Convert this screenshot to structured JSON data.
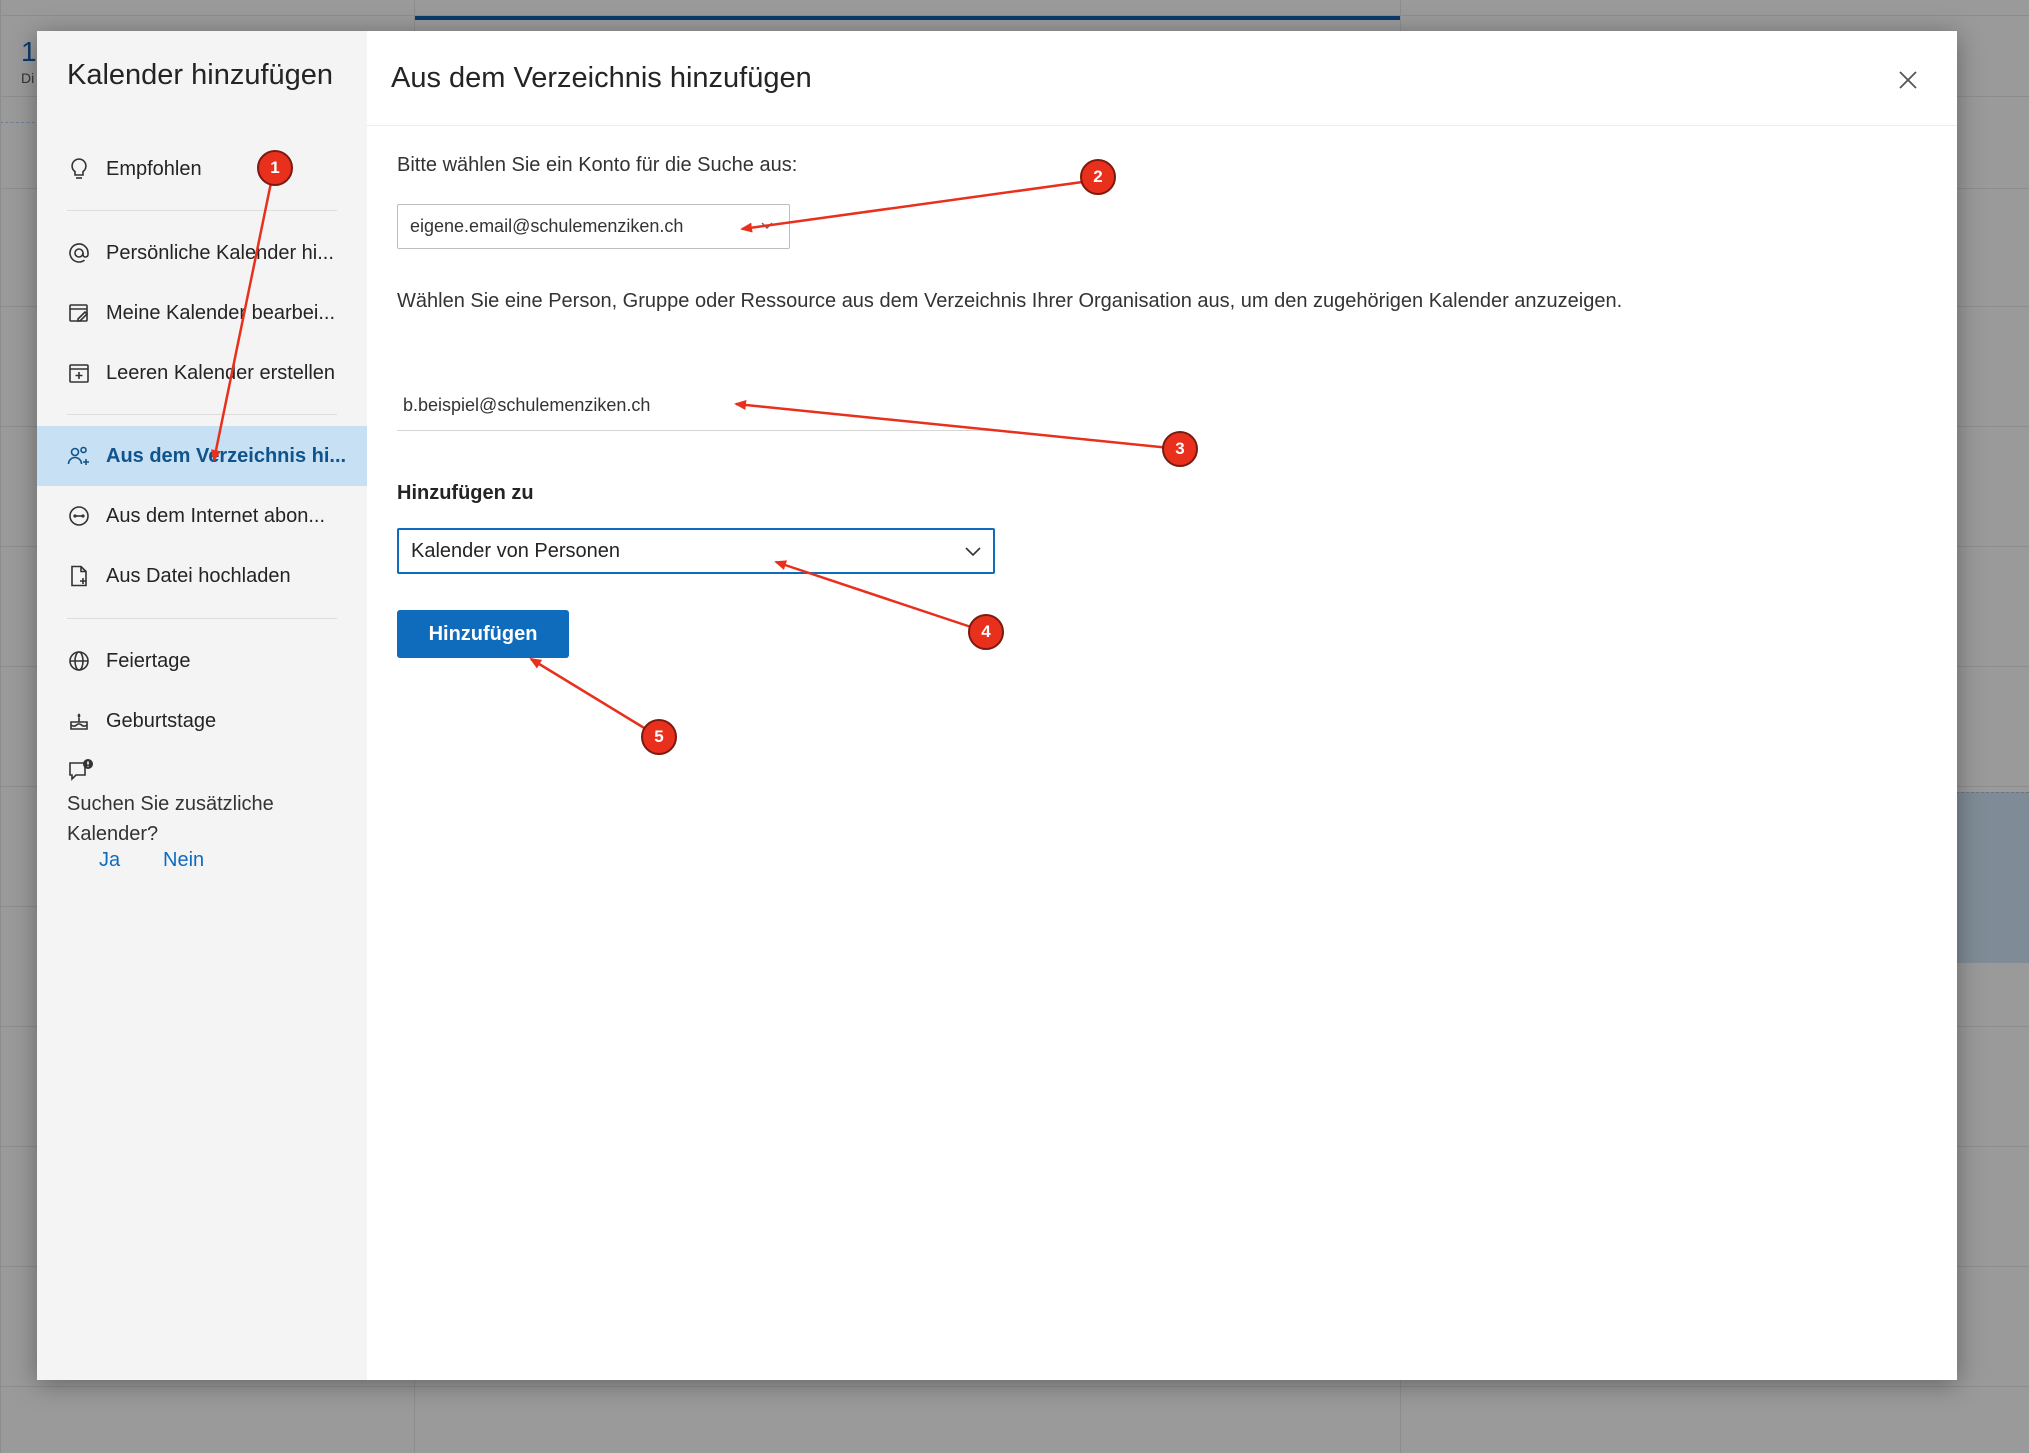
{
  "background": {
    "date_number": "1",
    "day_abbrev": "Di"
  },
  "sidebar": {
    "title": "Kalender hinzufügen",
    "items": [
      {
        "label": "Empfohlen",
        "icon": "lightbulb-icon"
      },
      {
        "label": "Persönliche Kalender hi...",
        "icon": "at-sign-icon"
      },
      {
        "label": "Meine Kalender bearbei...",
        "icon": "edit-calendar-icon"
      },
      {
        "label": "Leeren Kalender erstellen",
        "icon": "calendar-add-icon"
      },
      {
        "label": "Aus dem Verzeichnis hi...",
        "icon": "people-add-icon",
        "active": true
      },
      {
        "label": "Aus dem Internet abon...",
        "icon": "link-circle-icon"
      },
      {
        "label": "Aus Datei hochladen",
        "icon": "document-add-icon"
      },
      {
        "label": "Feiertage",
        "icon": "globe-icon"
      },
      {
        "label": "Geburtstage",
        "icon": "cake-icon"
      }
    ],
    "prompt": {
      "text": "Suchen Sie zusätzliche Kalender?",
      "yes": "Ja",
      "no": "Nein"
    }
  },
  "main": {
    "title": "Aus dem Verzeichnis hinzufügen",
    "account_label": "Bitte wählen Sie ein Konto für die Suche aus:",
    "account_value": "eigene.email@schulemenziken.ch",
    "description": "Wählen Sie eine Person, Gruppe oder Ressource aus dem Verzeichnis Ihrer Organisation aus, um den zugehörigen Kalender anzuzeigen.",
    "person_value": "b.beispiel@schulemenziken.ch",
    "add_to_label": "Hinzufügen zu",
    "add_to_value": "Kalender von Personen",
    "add_button": "Hinzufügen"
  },
  "annotations": {
    "markers": [
      "1",
      "2",
      "3",
      "4",
      "5"
    ],
    "color": "#e8301c"
  }
}
